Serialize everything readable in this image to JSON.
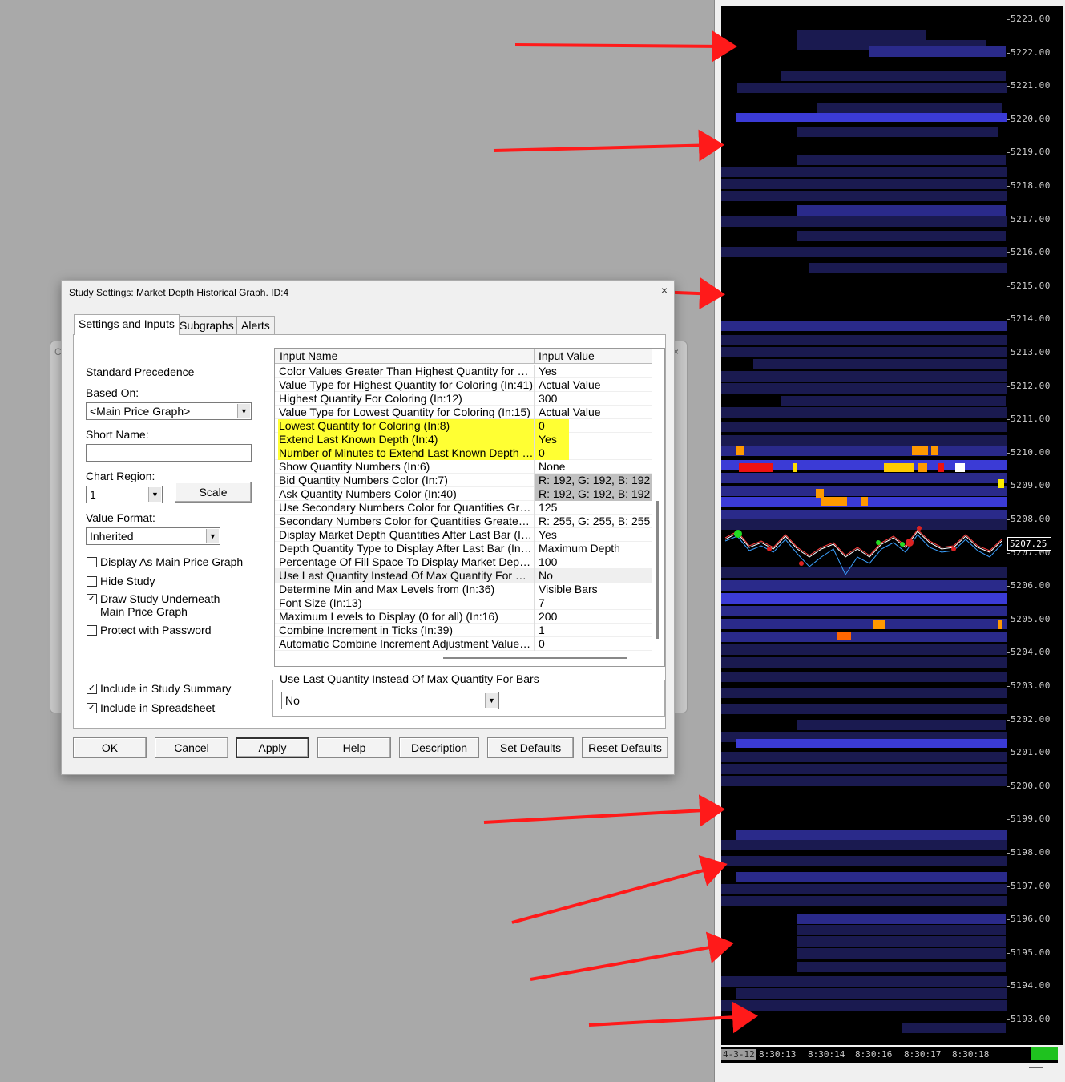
{
  "dialog": {
    "title": "Study Settings: Market Depth Historical Graph. ID:4",
    "close": "×",
    "tabs": [
      "Settings and Inputs",
      "Subgraphs",
      "Alerts"
    ],
    "standard_precedence": "Standard Precedence",
    "based_on_label": "Based On:",
    "based_on_value": "<Main Price Graph>",
    "short_name_label": "Short Name:",
    "short_name_value": "",
    "chart_region_label": "Chart Region:",
    "chart_region_value": "1",
    "scale_button": "Scale",
    "value_format_label": "Value Format:",
    "value_format_value": "Inherited",
    "checkboxes": [
      {
        "label": "Display As Main Price Graph",
        "checked": false
      },
      {
        "label": "Hide Study",
        "checked": false
      },
      {
        "label": "Draw Study Underneath",
        "label2": "Main Price Graph",
        "checked": true
      },
      {
        "label": "Protect with Password",
        "checked": false
      }
    ],
    "bottom_checkboxes": [
      {
        "label": "Include in Study Summary",
        "checked": true
      },
      {
        "label": "Include in Spreadsheet",
        "checked": true
      }
    ],
    "grid": {
      "col_name": "Input Name",
      "col_value": "Input Value",
      "rows": [
        {
          "name": "Color Values Greater Than Highest Quantity for Colo...",
          "value": "Yes"
        },
        {
          "name": "Value Type for Highest Quantity for Coloring   (In:41)",
          "value": "Actual Value"
        },
        {
          "name": "Highest Quantity For Coloring   (In:12)",
          "value": "300"
        },
        {
          "name": "Value Type for Lowest Quantity for Coloring   (In:15)",
          "value": "Actual Value"
        },
        {
          "name": "Lowest Quantity for Coloring   (In:8)",
          "value": "0",
          "highlight": true
        },
        {
          "name": "Extend Last Known Depth   (In:4)",
          "value": "Yes",
          "highlight": true
        },
        {
          "name": "Number of Minutes to Extend Last Known Depth (0 fo...",
          "value": "0",
          "highlight": true
        },
        {
          "name": "Show Quantity Numbers   (In:6)",
          "value": "None"
        },
        {
          "name": "Bid Quantity Numbers Color   (In:7)",
          "value": "R: 192, G: 192, B: 192",
          "gray": true
        },
        {
          "name": "Ask Quantity Numbers Color   (In:40)",
          "value": "R: 192, G: 192, B: 192",
          "gray": true
        },
        {
          "name": "Use Secondary Numbers Color for Quantities Great...",
          "value": "125"
        },
        {
          "name": "Secondary Numbers Color for Quantities Greater Th...",
          "value": "R: 255, G: 255, B: 255"
        },
        {
          "name": "Display Market Depth Quantities After Last Bar   (In:9)",
          "value": "Yes"
        },
        {
          "name": "Depth Quantity Type to Display After Last Bar   (In:14)",
          "value": "Maximum Depth"
        },
        {
          "name": "Percentage Of Fill Space To Display Market Depth ...",
          "value": "100"
        },
        {
          "name": "Use Last Quantity Instead Of Max Quantity For Bars  ...",
          "value": "No",
          "selected": true
        },
        {
          "name": "Determine Min and Max Levels from   (In:36)",
          "value": "Visible Bars"
        },
        {
          "name": "Font Size   (In:13)",
          "value": "7"
        },
        {
          "name": "Maximum Levels to Display (0 for all)   (In:16)",
          "value": "200"
        },
        {
          "name": "Combine Increment in Ticks   (In:39)",
          "value": "1"
        },
        {
          "name": "Automatic Combine Increment Adjustment Value (0 f...",
          "value": "0"
        }
      ]
    },
    "groupbox_label": "Use Last Quantity Instead Of Max Quantity For Bars",
    "groupbox_value": "No",
    "buttons": [
      "OK",
      "Cancel",
      "Apply",
      "Help",
      "Description",
      "Set Defaults",
      "Reset Defaults"
    ]
  },
  "chart": {
    "price_ticks": [
      "5223.00",
      "5222.00",
      "5221.00",
      "5220.00",
      "5219.00",
      "5218.00",
      "5217.00",
      "5216.00",
      "5215.00",
      "5214.00",
      "5213.00",
      "5212.00",
      "5211.00",
      "5210.00",
      "5209.00",
      "5208.00",
      "5207.00",
      "5206.00",
      "5205.00",
      "5204.00",
      "5203.00",
      "5202.00",
      "5201.00",
      "5200.00",
      "5199.00",
      "5198.00",
      "5197.00",
      "5196.00",
      "5195.00",
      "5194.00",
      "5193.00"
    ],
    "last_price": "5207.25",
    "date_badge": "4-3-12",
    "time_labels": [
      "8:30:13",
      "8:30:14",
      "8:30:16",
      "8:30:17",
      "8:30:18"
    ],
    "colors": {
      "depth_low": "#1a1a50",
      "depth_mid": "#2a2a8a",
      "depth_high": "#3b3bd6",
      "arrow": "#ff1a1a",
      "highlight": "#ffff33"
    }
  },
  "background": {
    "ghost_char": "C"
  }
}
